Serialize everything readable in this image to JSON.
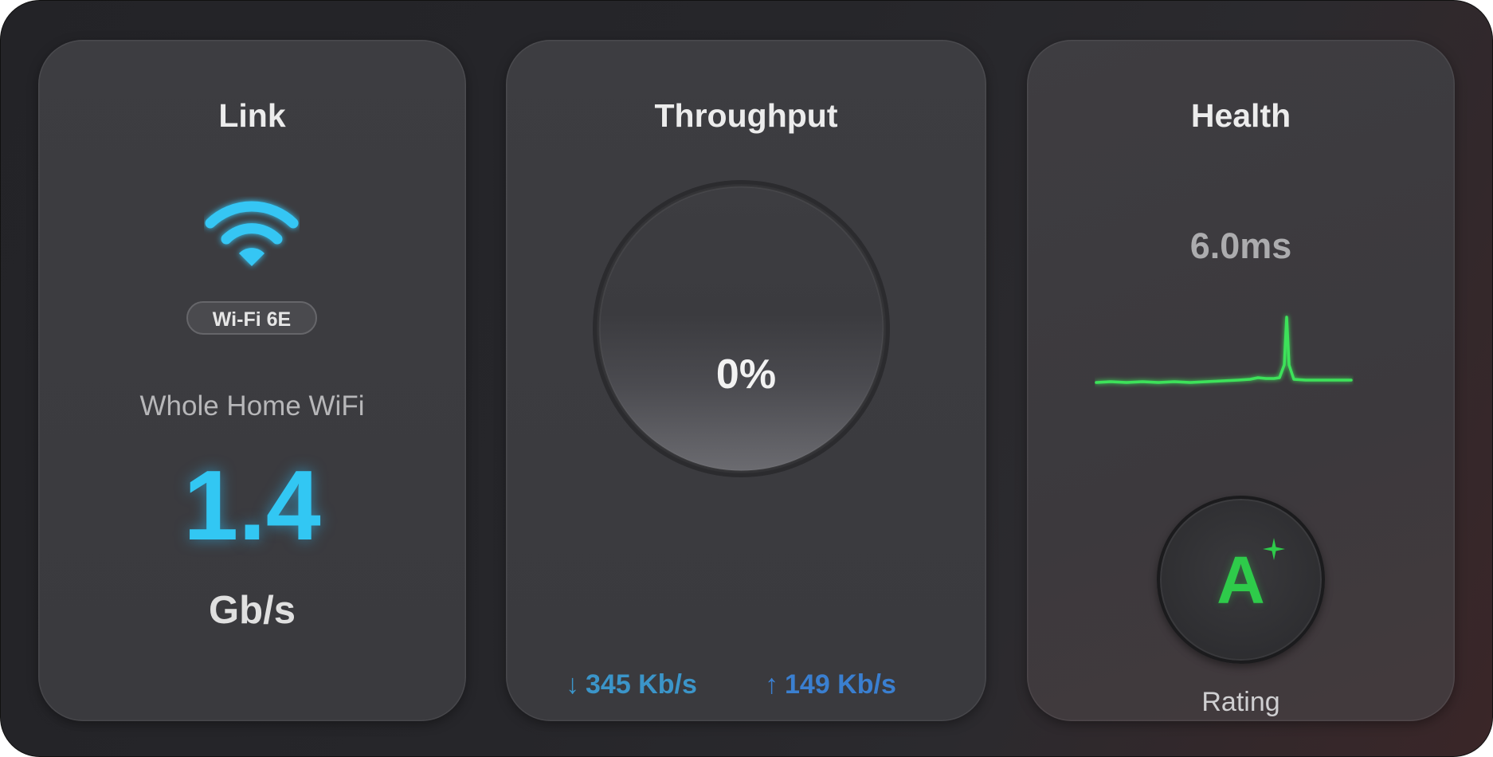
{
  "colors": {
    "accent_blue": "#32c7f3",
    "download_blue": "#3b95c9",
    "upload_blue": "#3a7fd0",
    "health_green": "#2ecb4a"
  },
  "link": {
    "title": "Link",
    "icon": "wifi-icon",
    "standard_badge": "Wi-Fi 6E",
    "network_name": "Whole Home WiFi",
    "speed": "1.4",
    "unit": "Gb/s"
  },
  "throughput": {
    "title": "Throughput",
    "utilization": "0%",
    "utilization_fraction": 0.0,
    "download_arrow": "↓",
    "download": "345 Kb/s",
    "upload_arrow": "↑",
    "upload": "149 Kb/s"
  },
  "health": {
    "title": "Health",
    "latency": "6.0ms",
    "grade": "A",
    "grade_modifier_icon": "sparkle-plus-icon",
    "rating_label": "Rating"
  }
}
